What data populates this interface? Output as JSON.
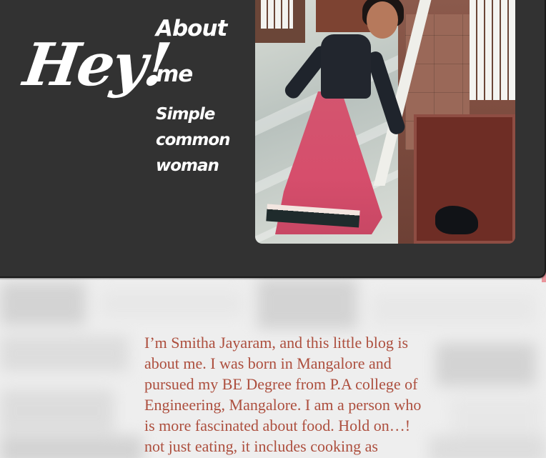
{
  "hero": {
    "greeting": "Hey!",
    "title": "About me",
    "tagline": "Simple common woman",
    "photo": {
      "description_icon": "profile-photo"
    }
  },
  "content": {
    "intro_text": "I’m Smitha Jayaram, and this little blog is about me. I was born in Mangalore and pursued my BE Degree from P.A college of Engineering, Mangalore. I am a person who is more fascinated about food. Hold on…! not just eating, it includes cooking as"
  },
  "colors": {
    "hero_background": "#323232",
    "text_accent": "#ad4f3e",
    "hero_text": "#ffffff"
  }
}
